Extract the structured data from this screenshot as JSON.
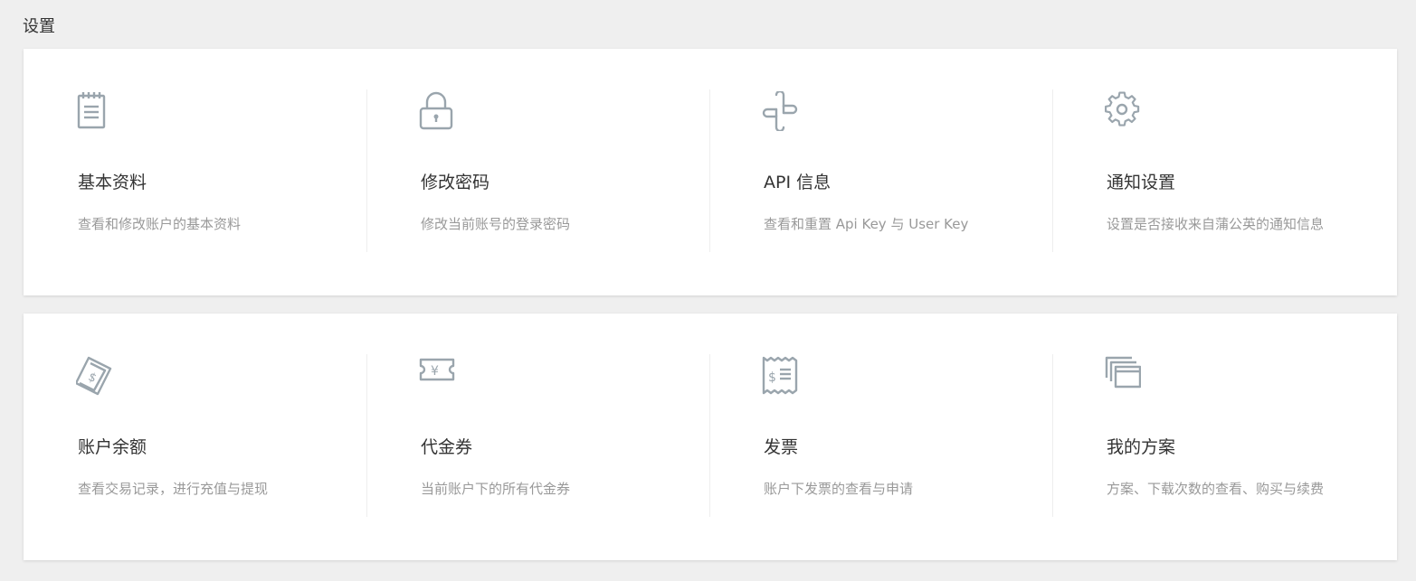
{
  "page": {
    "title": "设置"
  },
  "row1": [
    {
      "title": "基本资料",
      "desc": "查看和修改账户的基本资料",
      "icon": "notepad-icon"
    },
    {
      "title": "修改密码",
      "desc": "修改当前账号的登录密码",
      "icon": "lock-icon"
    },
    {
      "title": "API 信息",
      "desc": "查看和重置 Api Key 与 User Key",
      "icon": "api-link-icon"
    },
    {
      "title": "通知设置",
      "desc": "设置是否接收来自蒲公英的通知信息",
      "icon": "gear-icon"
    }
  ],
  "row2": [
    {
      "title": "账户余额",
      "desc": "查看交易记录，进行充值与提现",
      "icon": "money-bill-icon"
    },
    {
      "title": "代金券",
      "desc": "当前账户下的所有代金券",
      "icon": "yen-coupon-icon"
    },
    {
      "title": "发票",
      "desc": "账户下发票的查看与申请",
      "icon": "receipt-icon"
    },
    {
      "title": "我的方案",
      "desc": "方案、下载次数的查看、购买与续费",
      "icon": "stacked-windows-icon"
    }
  ],
  "colors": {
    "icon": "#9aa5ad",
    "highlight": "#e53935",
    "title": "#333333",
    "desc": "#999999"
  }
}
